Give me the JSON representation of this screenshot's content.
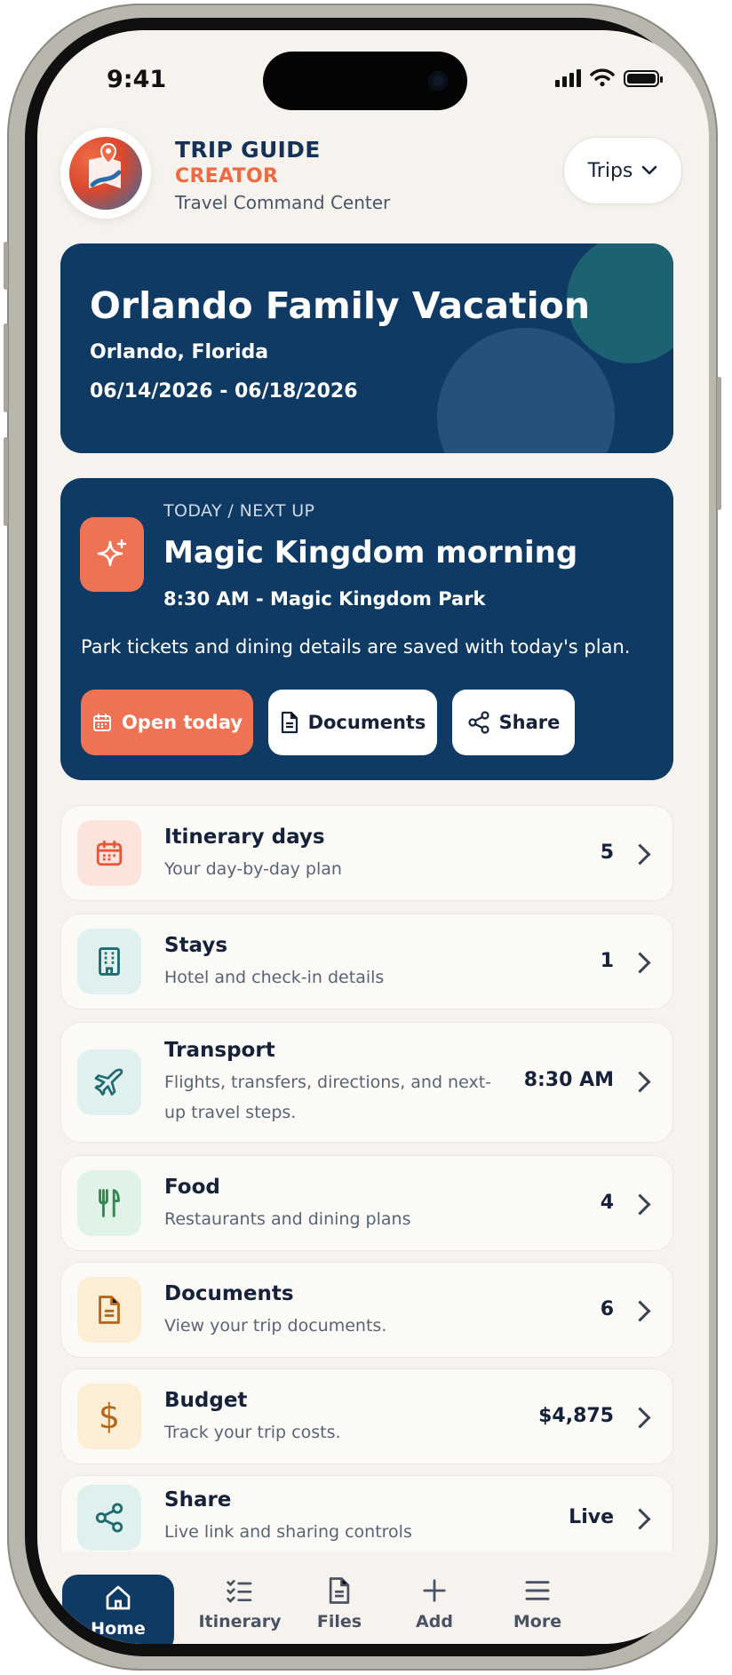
{
  "status_bar": {
    "time": "9:41"
  },
  "header": {
    "brand_line1": "TRIP GUIDE",
    "brand_line2": "CREATOR",
    "tagline": "Travel Command Center",
    "trips_button": "Trips"
  },
  "trip": {
    "title": "Orlando Family Vacation",
    "location": "Orlando, Florida",
    "dates": "06/14/2026 - 06/18/2026"
  },
  "next_up": {
    "kicker": "TODAY / NEXT UP",
    "title": "Magic Kingdom morning",
    "time_place": "8:30 AM - Magic Kingdom Park",
    "description": "Park tickets and dining details are saved with today's plan.",
    "actions": {
      "open_today": "Open today",
      "documents": "Documents",
      "share": "Share"
    }
  },
  "sections": [
    {
      "title": "Itinerary days",
      "subtitle": "Your day-by-day plan",
      "value": "5",
      "icon": "calendar-icon",
      "color": "#e8563a"
    },
    {
      "title": "Stays",
      "subtitle": "Hotel and check-in details",
      "value": "1",
      "icon": "building-icon",
      "color": "#1f6b70"
    },
    {
      "title": "Transport",
      "subtitle": "Flights, transfers, directions, and next-up travel steps.",
      "value": "8:30 AM",
      "icon": "plane-icon",
      "color": "#1f6b70"
    },
    {
      "title": "Food",
      "subtitle": "Restaurants and dining plans",
      "value": "4",
      "icon": "utensils-icon",
      "color": "#2e8a4e"
    },
    {
      "title": "Documents",
      "subtitle": "View your trip documents.",
      "value": "6",
      "icon": "document-icon",
      "color": "#b36a1e"
    },
    {
      "title": "Budget",
      "subtitle": "Track your trip costs.",
      "value": "$4,875",
      "icon": "dollar-icon",
      "color": "#b36a1e"
    },
    {
      "title": "Share",
      "subtitle": "Live link and sharing controls",
      "value": "Live",
      "icon": "share-icon",
      "color": "#1f6b70"
    }
  ],
  "tabbar": [
    {
      "label": "Home",
      "icon": "home-icon",
      "active": true
    },
    {
      "label": "Itinerary",
      "icon": "checklist-icon"
    },
    {
      "label": "Files",
      "icon": "file-icon"
    },
    {
      "label": "Add",
      "icon": "plus-icon"
    },
    {
      "label": "More",
      "icon": "menu-icon"
    }
  ],
  "colors": {
    "navy": "#0f3a64",
    "accent": "#ee7354",
    "background": "#f6f3ee"
  }
}
